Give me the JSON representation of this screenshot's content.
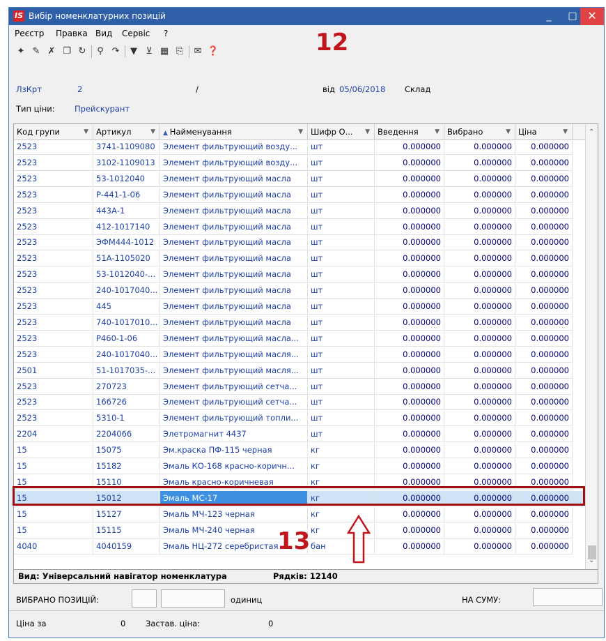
{
  "window": {
    "title": "Вибір номенклатурних позицій",
    "logo": "IS",
    "minimize": "_",
    "maximize": "□",
    "close": "✕"
  },
  "menu": [
    "Реєстр",
    "Правка",
    "Вид",
    "Сервіс",
    "?"
  ],
  "annotations": {
    "top": "12",
    "bottom": "13"
  },
  "header": {
    "lzkrt_label": "ЛзКрт",
    "lzkrt_value": "2",
    "slash": "/",
    "date_label": "від",
    "date_value": "05/06/2018",
    "warehouse_label": "Склад",
    "price_type_label": "Тип ціни:",
    "price_type_value": "Прейскурант"
  },
  "columns": [
    "Код групи",
    "Артикул",
    "Найменування",
    "Шифр О...",
    "Введення",
    "Вибрано",
    "Ціна"
  ],
  "rows": [
    [
      "2523",
      "3741-1109080",
      "Элемент фильтрующий возду...",
      "шт",
      "0.000000",
      "0.000000",
      "0.000000"
    ],
    [
      "2523",
      "3102-1109013",
      "Элемент фильтрующий возду...",
      "шт",
      "0.000000",
      "0.000000",
      "0.000000"
    ],
    [
      "2523",
      "53-1012040",
      "Элемент фильтрующий масла",
      "шт",
      "0.000000",
      "0.000000",
      "0.000000"
    ],
    [
      "2523",
      "Р-441-1-06",
      "Элемент фильтрующий масла",
      "шт",
      "0.000000",
      "0.000000",
      "0.000000"
    ],
    [
      "2523",
      "443А-1",
      "Элемент фильтрующий масла",
      "шт",
      "0.000000",
      "0.000000",
      "0.000000"
    ],
    [
      "2523",
      "412-1017140",
      "Элемент фильтрующий масла",
      "шт",
      "0.000000",
      "0.000000",
      "0.000000"
    ],
    [
      "2523",
      "ЭФМ444-1012",
      "Элемент фильтрующий масла",
      "шт",
      "0.000000",
      "0.000000",
      "0.000000"
    ],
    [
      "2523",
      "51А-1105020",
      "Элемент фильтрующий масла",
      "шт",
      "0.000000",
      "0.000000",
      "0.000000"
    ],
    [
      "2523",
      "53-1012040-...",
      "Элемент фильтрующий масла",
      "шт",
      "0.000000",
      "0.000000",
      "0.000000"
    ],
    [
      "2523",
      "240-1017040...",
      "Элемент фильтрующий масла",
      "шт",
      "0.000000",
      "0.000000",
      "0.000000"
    ],
    [
      "2523",
      "445",
      "Элемент фильтрующий масла",
      "шт",
      "0.000000",
      "0.000000",
      "0.000000"
    ],
    [
      "2523",
      "740-1017010...",
      "Элемент фильтрующий масла",
      "шт",
      "0.000000",
      "0.000000",
      "0.000000"
    ],
    [
      "2523",
      "Р460-1-06",
      "Элемент фильтрующий масла...",
      "шт",
      "0.000000",
      "0.000000",
      "0.000000"
    ],
    [
      "2523",
      "240-1017040...",
      "Элемент фильтрующий масля...",
      "шт",
      "0.000000",
      "0.000000",
      "0.000000"
    ],
    [
      "2501",
      "51-1017035-...",
      "Элемент фильтрующий масля...",
      "шт",
      "0.000000",
      "0.000000",
      "0.000000"
    ],
    [
      "2523",
      "270723",
      "Элемент фильтрующий сетча...",
      "шт",
      "0.000000",
      "0.000000",
      "0.000000"
    ],
    [
      "2523",
      "166726",
      "Элемент фильтрующий сетча...",
      "шт",
      "0.000000",
      "0.000000",
      "0.000000"
    ],
    [
      "2523",
      "5310-1",
      "Элемент фильтрующий топли...",
      "шт",
      "0.000000",
      "0.000000",
      "0.000000"
    ],
    [
      "2204",
      "2204066",
      "Элетромагнит 4437",
      "шт",
      "0.000000",
      "0.000000",
      "0.000000"
    ],
    [
      "15",
      "15075",
      "Эм.краска ПФ-115 черная",
      "кг",
      "0.000000",
      "0.000000",
      "0.000000"
    ],
    [
      "15",
      "15182",
      "Эмаль КО-168 красно-коричн...",
      "кг",
      "0.000000",
      "0.000000",
      "0.000000"
    ],
    [
      "15",
      "15110",
      "Эмаль красно-коричневая",
      "кг",
      "0.000000",
      "0.000000",
      "0.000000"
    ],
    [
      "15",
      "15012",
      "Эмаль МС-17",
      "кг",
      "0.000000",
      "0.000000",
      "0.000000"
    ],
    [
      "15",
      "15127",
      "Эмаль МЧ-123 черная",
      "кг",
      "0.000000",
      "0.000000",
      "0.000000"
    ],
    [
      "15",
      "15115",
      "Эмаль МЧ-240 черная",
      "кг",
      "0.000000",
      "0.000000",
      "0.000000"
    ],
    [
      "4040",
      "4040159",
      "Эмаль НЦ-272 серебристая",
      "бан",
      "0.000000",
      "0.000000",
      "0.000000"
    ]
  ],
  "selected_row": 22,
  "grid_status": {
    "view": "Вид: Універсальний навігатор номенклатура",
    "rows_label": "Рядків: 12140"
  },
  "footer": {
    "selected_positions_label": "ВИБРАНО ПОЗИЦІЙ:",
    "units_label": "одиниц",
    "sum_label": "НА СУМУ:",
    "price_label": "Ціна за",
    "price_value": "0",
    "deposit_label": "Застав. ціна:",
    "deposit_value": "0"
  },
  "colors": {
    "titlebar": "#2f5fa7",
    "accent_red": "#c0151b",
    "selection": "#3d8fe0"
  }
}
